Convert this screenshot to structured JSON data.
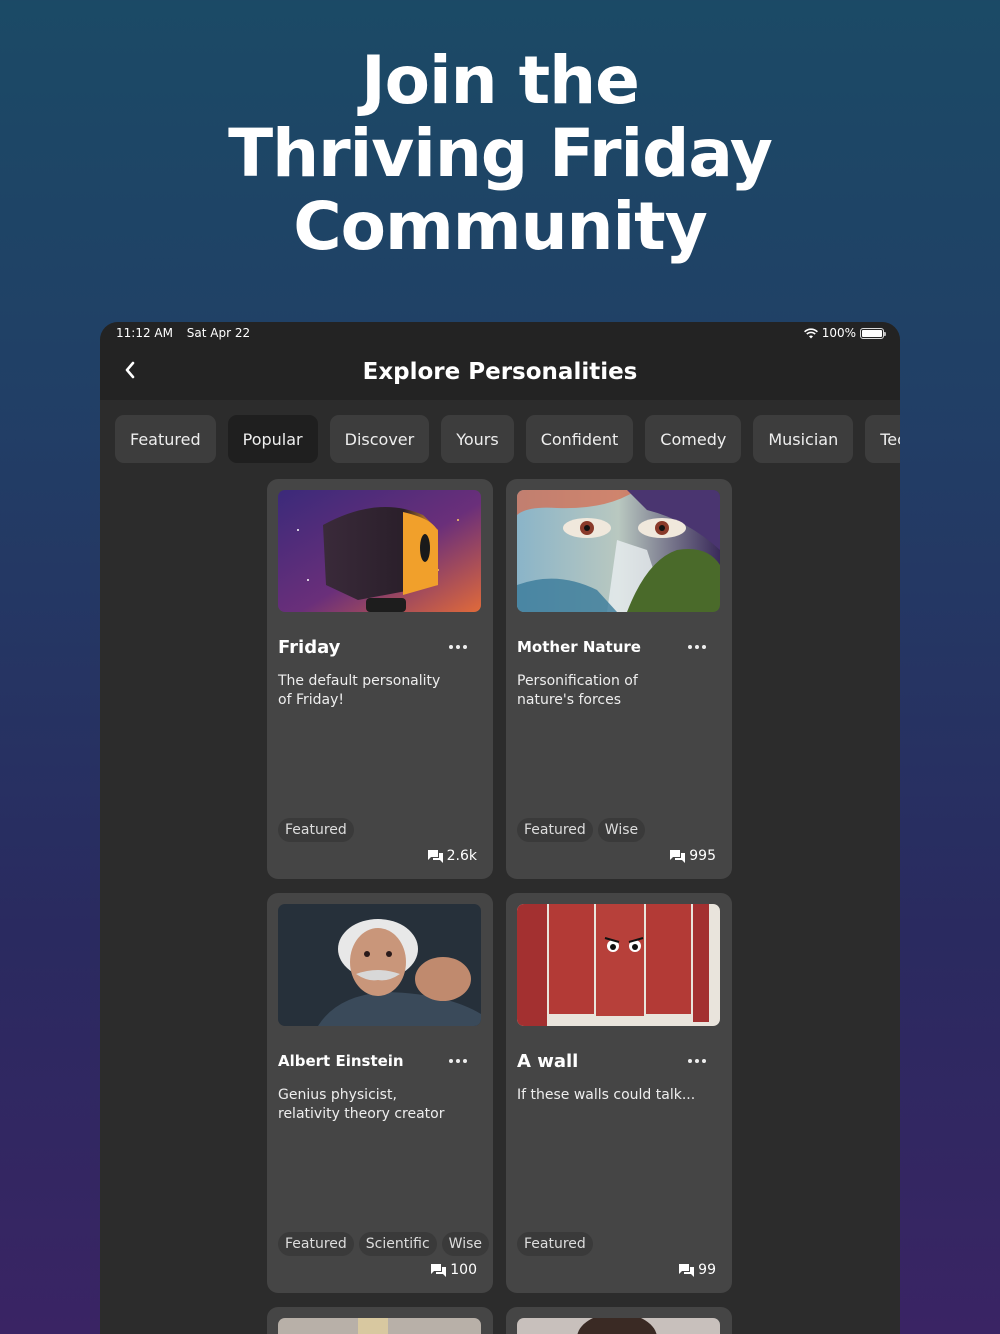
{
  "hero": {
    "line1": "Join the",
    "line2": "Thriving Friday",
    "line3": "Community"
  },
  "status": {
    "time": "11:12 AM",
    "date": "Sat Apr 22",
    "battery": "100%"
  },
  "nav": {
    "title": "Explore Personalities"
  },
  "tabs": [
    "Featured",
    "Popular",
    "Discover",
    "Yours",
    "Confident",
    "Comedy",
    "Musician",
    "Tech-"
  ],
  "active_tab": "Popular",
  "cards": [
    {
      "name": "Friday",
      "desc": "The default personality of Friday!",
      "tags": [
        "Featured"
      ],
      "count": "2.6k"
    },
    {
      "name": "Mother Nature",
      "desc": "Personification of nature's forces",
      "tags": [
        "Featured",
        "Wise"
      ],
      "count": "995"
    },
    {
      "name": "Albert Einstein",
      "desc": "Genius physicist, relativity theory creator",
      "tags": [
        "Featured",
        "Scientific",
        "Wise"
      ],
      "count": "100"
    },
    {
      "name": "A wall",
      "desc": "If these walls could talk...",
      "tags": [
        "Featured"
      ],
      "count": "99"
    }
  ]
}
